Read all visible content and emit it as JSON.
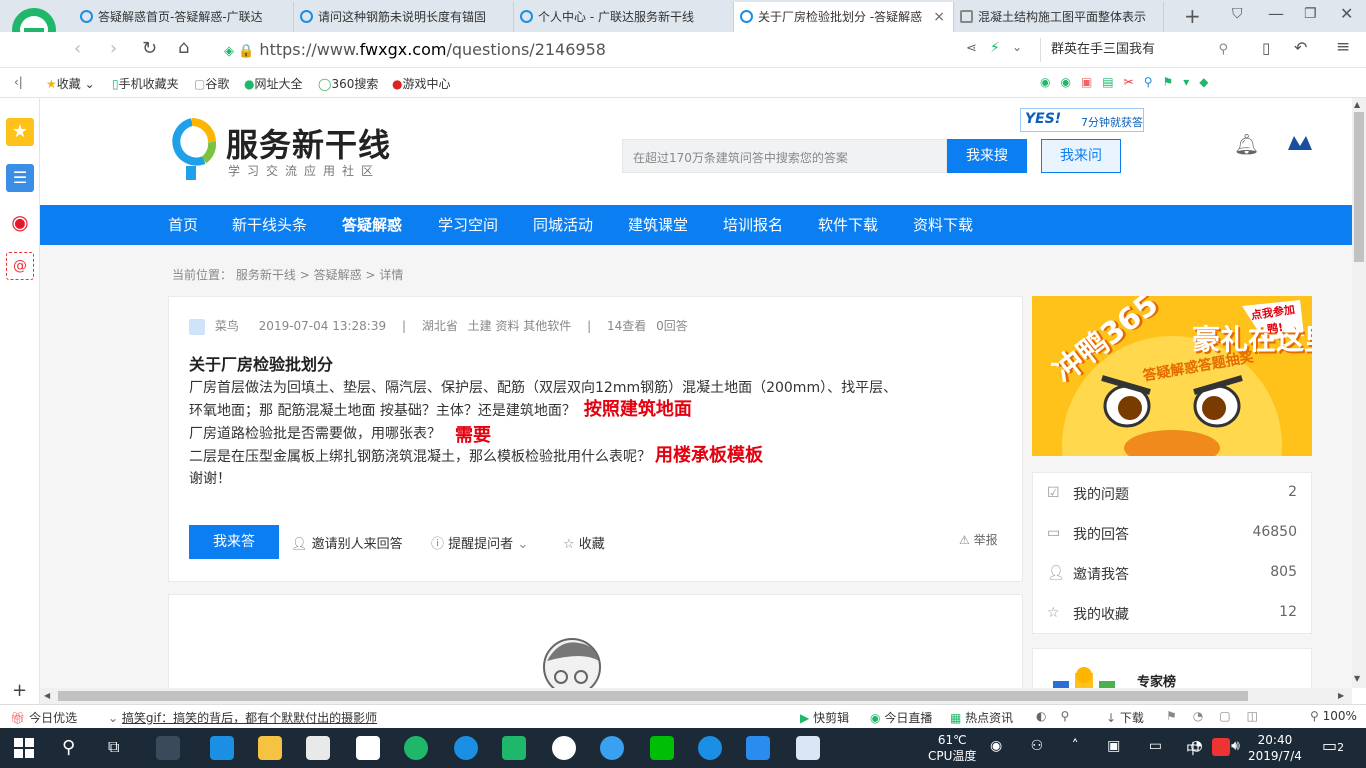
{
  "browser": {
    "tabs": [
      {
        "title": "答疑解惑首页-答疑解惑-广联达"
      },
      {
        "title": "请问这种钢筋未说明长度有锚固"
      },
      {
        "title": "个人中心 - 广联达服务新干线"
      },
      {
        "title": "关于厂房检验批划分 -答疑解惑"
      },
      {
        "title": "混凝土结构施工图平面整体表示"
      }
    ],
    "url_prefix": "https://www.",
    "url_domain": "fwxgx.com",
    "url_path": "/questions/2146958",
    "search_box": "群英在手三国我有",
    "favorites": [
      "收藏",
      "手机收藏夹",
      "谷歌",
      "网址大全",
      "360搜索",
      "游戏中心"
    ]
  },
  "site": {
    "logo_main": "服务新干线",
    "logo_sub": "学习交流应用社区",
    "search_placeholder": "在超过170万条建筑问答中搜索您的答案",
    "search_button": "我来搜",
    "ask_button": "我来问",
    "promo_badge_yes": "YES!",
    "promo_badge_text": "7分钟就获答",
    "nav": [
      "首页",
      "新干线头条",
      "答疑解惑",
      "学习空间",
      "同城活动",
      "建筑课堂",
      "培训报名",
      "软件下载",
      "资料下载"
    ],
    "nav_active_index": 2
  },
  "breadcrumb": {
    "label": "当前位置：",
    "items": [
      "服务新干线",
      "答疑解惑",
      "详情"
    ],
    "sep": ">"
  },
  "question": {
    "author": "菜鸟",
    "time": "2019-07-04 13:28:39",
    "location": "湖北省",
    "tags": "土建 资料 其他软件",
    "views": "14查看",
    "answers": "0回答",
    "title": "关于厂房检验批划分",
    "line1": "厂房首层做法为回填土、垫层、隔汽层、保护层、配筋（双层双向12mm钢筋）混凝土地面（200mm）、找平层、",
    "line2": "环氧地面；那 配筋混凝土地面 按基础？主体？还是建筑地面？",
    "note1": "按照建筑地面",
    "line3": "厂房道路检验批是否需要做，用哪张表？",
    "note2": "需要",
    "line4": "二层是在压型金属板上绑扎钢筋浇筑混凝土，那么模板检验批用什么表呢？",
    "note3": "用楼承板模板",
    "line5": "谢谢！",
    "answer_button": "我来答",
    "invite": "邀请别人来回答",
    "remind": "提醒提问者",
    "favorite": "收藏",
    "report": "举报"
  },
  "promo": {
    "text1": "冲鸭365",
    "text2": "豪礼在这里",
    "text3": "答疑解惑答题抽奖",
    "bubble": "点我参加鸭!"
  },
  "sidebar": {
    "items": [
      {
        "label": "我的问题",
        "count": "2"
      },
      {
        "label": "我的回答",
        "count": "46850"
      },
      {
        "label": "邀请我答",
        "count": "805"
      },
      {
        "label": "我的收藏",
        "count": "12"
      }
    ],
    "expert_title": "专家榜"
  },
  "statusbar": {
    "left": "今日优选",
    "news": "搞笑gif：搞笑的背后，都有个默默付出的摄影师",
    "items": [
      "快剪辑",
      "今日直播",
      "热点资讯",
      "下载"
    ],
    "zoom": "100%"
  },
  "taskbar": {
    "temp": "61℃",
    "temp_label": "CPU温度",
    "ime": "中",
    "time": "20:40",
    "date": "2019/7/4",
    "notif": "2"
  },
  "colors": {
    "nav_blue": "#0b7ef2",
    "note_red": "#e3000f",
    "promo_yellow": "#ffc21a"
  }
}
